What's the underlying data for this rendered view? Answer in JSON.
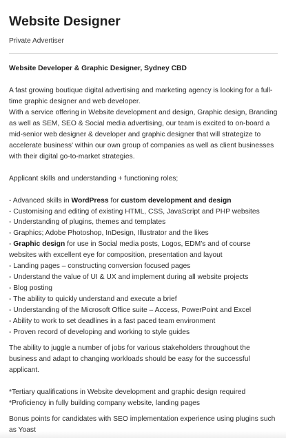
{
  "listing": {
    "title": "Website Designer",
    "advertiser": "Private Advertiser"
  },
  "description": {
    "headline": "Website Developer & Graphic Designer, Sydney CBD",
    "intro": "A fast growing boutique digital advertising and marketing agency is looking for a full-time graphic designer and web developer.",
    "service": "With a service offering in Website development and design, Graphic design, Branding as well as SEM, SEO & Social media advertising, our team is excited to on-board a mid-senior web designer & developer and graphic designer that will strategize to accelerate business' within our own group of companies as well as client businesses with their digital go-to-market strategies.",
    "skills_heading": "Applicant skills and understanding + functioning roles;",
    "skills": {
      "s1_prefix": "- Advanced skills in ",
      "s1_bold1": "WordPress",
      "s1_mid": " for ",
      "s1_bold2": "custom development and design",
      "s2": "- Customising and editing of existing HTML, CSS, JavaScript and PHP websites",
      "s3": "- Understanding of plugins, themes and templates",
      "s4": "- Graphics; Adobe Photoshop, InDesign, Illustrator and the likes",
      "s5_prefix": "- ",
      "s5_bold": "Graphic design",
      "s5_rest": " for use in Social media posts, Logos, EDM’s and of course websites with excellent eye for composition, presentation and layout",
      "s6": "- Landing pages – constructing conversion focused pages",
      "s7": "- Understand the value of UI & UX and implement during all website projects",
      "s8": "- Blog posting",
      "s9": "- The ability to quickly understand and execute a brief",
      "s10": "- Understanding of the Microsoft Office suite – Access, PowerPoint and Excel",
      "s11": "- Ability to work to set deadlines in a fast paced team environment",
      "s12": "- Proven record of developing and working to style guides"
    },
    "juggle": "The ability to juggle a number of jobs for various stakeholders throughout the business and adapt to changing workloads should be easy for the successful applicant.",
    "req1": "*Tertiary qualifications in Website development and graphic design required",
    "req2": "*Proficiency in fully building company website, landing pages",
    "bonus": "Bonus points for candidates with SEO implementation experience using plugins such as Yoast"
  }
}
